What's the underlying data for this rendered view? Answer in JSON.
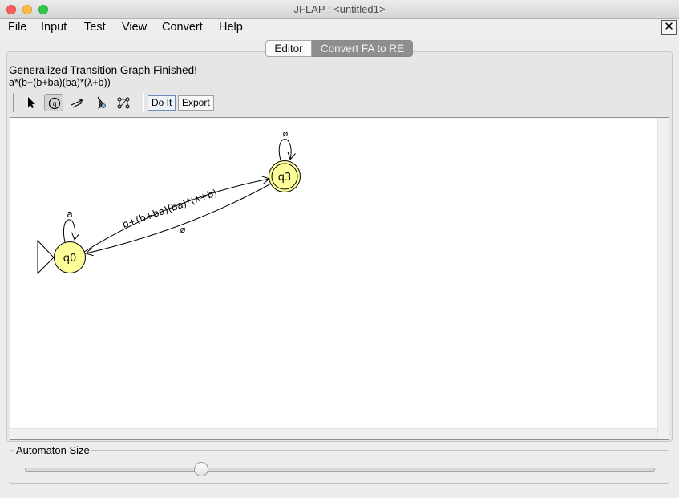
{
  "window": {
    "title": "JFLAP : <untitled1>"
  },
  "menu": [
    "File",
    "Input",
    "Test",
    "View",
    "Convert",
    "Help"
  ],
  "close_button": "✕",
  "tabs": {
    "editor": "Editor",
    "convert": "Convert FA to RE"
  },
  "status": {
    "message": "Generalized Transition Graph Finished!",
    "regex": "a*(b+(b+ba)(ba)*(λ+b))"
  },
  "toolbar": {
    "tools": [
      "attribute-editor-icon",
      "state-creator-icon",
      "transition-creator-icon",
      "deleter-icon",
      "collapse-icon"
    ],
    "active_tool": "state-creator-icon",
    "do_it": "Do It",
    "export": "Export"
  },
  "automaton": {
    "states": [
      {
        "id": "q0",
        "initial": true,
        "final": false
      },
      {
        "id": "q3",
        "initial": false,
        "final": true
      }
    ],
    "transitions": [
      {
        "from": "q0",
        "to": "q0",
        "label": "a"
      },
      {
        "from": "q0",
        "to": "q3",
        "label": "b+(b+ba)(ba)*(λ+b)"
      },
      {
        "from": "q3",
        "to": "q0",
        "label": "ø"
      },
      {
        "from": "q3",
        "to": "q3",
        "label": "ø"
      }
    ],
    "state_color": "#ffff99"
  },
  "size_panel": {
    "label": "Automaton Size",
    "value": 0.28
  }
}
